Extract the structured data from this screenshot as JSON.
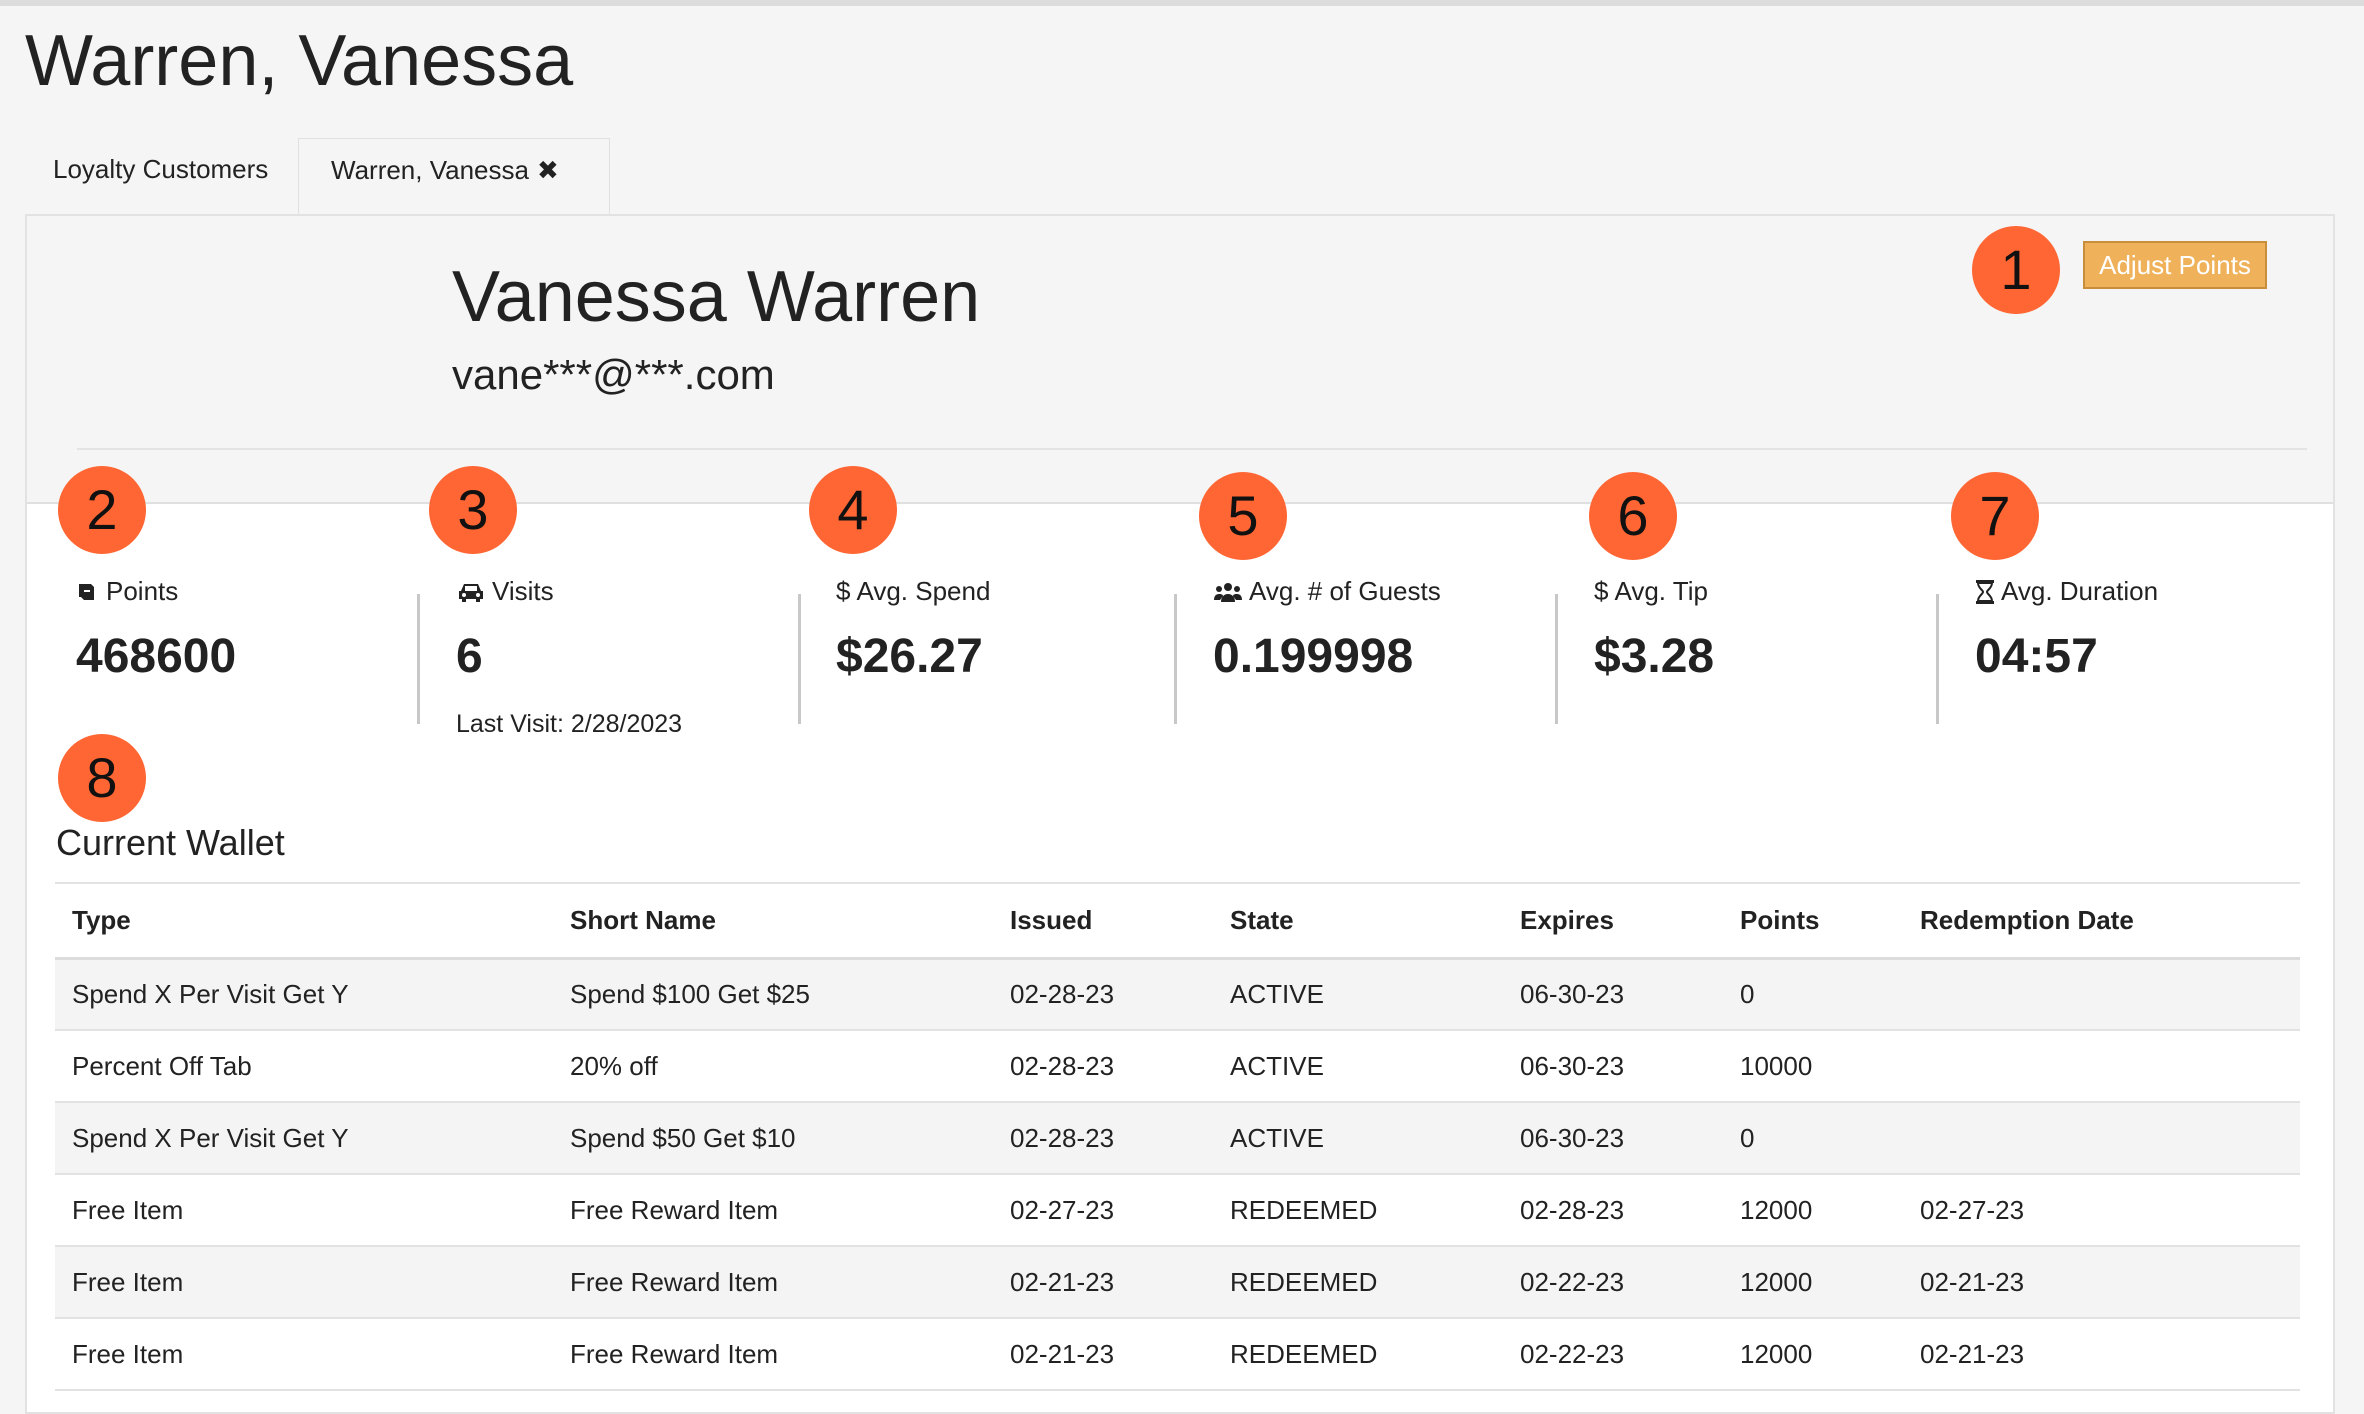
{
  "page": {
    "title": "Warren, Vanessa"
  },
  "tabs": [
    {
      "label": "Loyalty Customers"
    },
    {
      "label": "Warren, Vanessa",
      "close_icon": "close-icon"
    }
  ],
  "customer": {
    "name": "Vanessa Warren",
    "email": "vane***@***.com"
  },
  "actions": {
    "adjust_points_label": "Adjust Points"
  },
  "markers": [
    "1",
    "2",
    "3",
    "4",
    "5",
    "6",
    "7",
    "8"
  ],
  "stats": [
    {
      "label": "Points",
      "value": "468600",
      "icon": "ticket-icon"
    },
    {
      "label": "Visits",
      "value": "6",
      "sub": "Last Visit: 2/28/2023",
      "icon": "car-icon"
    },
    {
      "label": "Avg. Spend",
      "value": "$26.27",
      "icon": "dollar-icon"
    },
    {
      "label": "Avg. # of Guests",
      "value": "0.199998",
      "icon": "users-icon"
    },
    {
      "label": "Avg. Tip",
      "value": "$3.28",
      "icon": "dollar-icon"
    },
    {
      "label": "Avg. Duration",
      "value": "04:57",
      "icon": "hourglass-icon"
    }
  ],
  "wallet": {
    "title": "Current Wallet",
    "columns": [
      "Type",
      "Short Name",
      "Issued",
      "State",
      "Expires",
      "Points",
      "Redemption Date"
    ],
    "rows": [
      [
        "Spend X Per Visit Get Y",
        "Spend $100 Get $25",
        "02-28-23",
        "ACTIVE",
        "06-30-23",
        "0",
        ""
      ],
      [
        "Percent Off Tab",
        "20% off",
        "02-28-23",
        "ACTIVE",
        "06-30-23",
        "10000",
        ""
      ],
      [
        "Spend X Per Visit Get Y",
        "Spend $50 Get $10",
        "02-28-23",
        "ACTIVE",
        "06-30-23",
        "0",
        ""
      ],
      [
        "Free Item",
        "Free Reward Item",
        "02-27-23",
        "REDEEMED",
        "02-28-23",
        "12000",
        "02-27-23"
      ],
      [
        "Free Item",
        "Free Reward Item",
        "02-21-23",
        "REDEEMED",
        "02-22-23",
        "12000",
        "02-21-23"
      ],
      [
        "Free Item",
        "Free Reward Item",
        "02-21-23",
        "REDEEMED",
        "02-22-23",
        "12000",
        "02-21-23"
      ]
    ]
  },
  "colors": {
    "badge": "#ff6633",
    "button": "#efb15a",
    "row_stripe": "#f4f4f4"
  }
}
